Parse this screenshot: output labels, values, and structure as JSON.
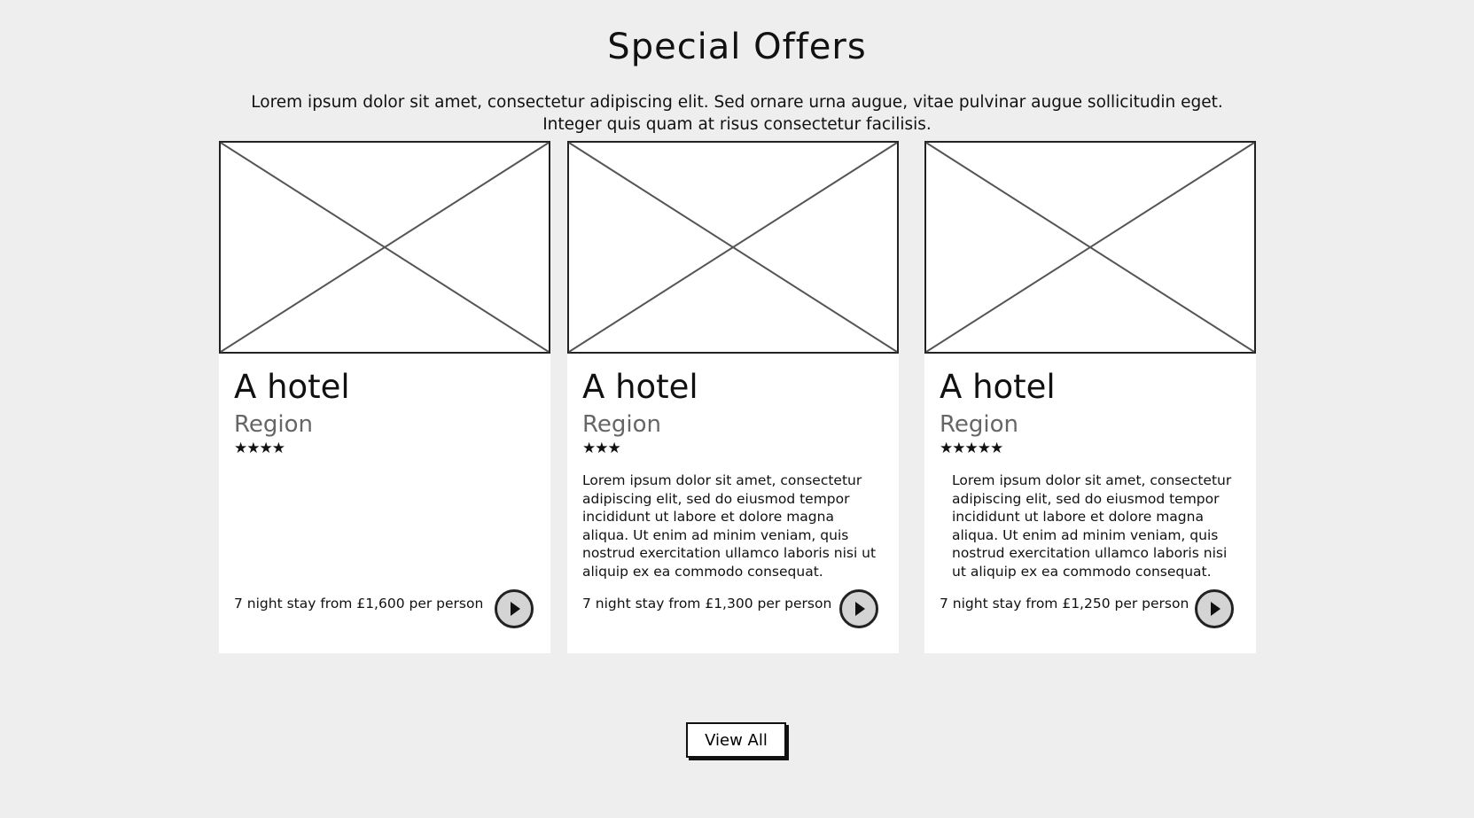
{
  "section": {
    "title": "Special Offers",
    "intro": "Lorem ipsum dolor sit amet, consectetur adipiscing elit. Sed ornare urna augue, vitae pulvinar augue sollicitudin eget. Integer quis quam at risus consectetur facilisis."
  },
  "cards": [
    {
      "name": "A hotel",
      "region": "Region",
      "stars": "★★★★",
      "rating": 4,
      "description": "",
      "price": "7 night stay from £1,600 per person"
    },
    {
      "name": "A hotel",
      "region": "Region",
      "stars": "★★★",
      "rating": 3,
      "description": "Lorem ipsum dolor sit amet, consectetur adipiscing elit, sed do eiusmod tempor incididunt ut labore et dolore magna aliqua. Ut enim ad minim veniam, quis nostrud exercitation ullamco laboris nisi ut aliquip ex ea commodo consequat.",
      "price": "7 night stay from £1,300 per person"
    },
    {
      "name": "A hotel",
      "region": "Region",
      "stars": "★★★★★",
      "rating": 5,
      "description": "Lorem ipsum dolor sit amet, consectetur adipiscing elit, sed do eiusmod tempor incididunt ut labore et dolore magna aliqua. Ut enim ad minim veniam, quis nostrud exercitation ullamco laboris nisi ut aliquip ex ea commodo consequat.",
      "price": "7 night stay from £1,250 per person"
    }
  ],
  "icons": {
    "image_placeholder": "image-placeholder-icon",
    "play": "play-icon"
  },
  "actions": {
    "view_all_label": "View All"
  },
  "colors": {
    "background": "#eeeeee",
    "card": "#ffffff",
    "region_text": "#666666",
    "play_button_fill": "#d4d4d4"
  }
}
